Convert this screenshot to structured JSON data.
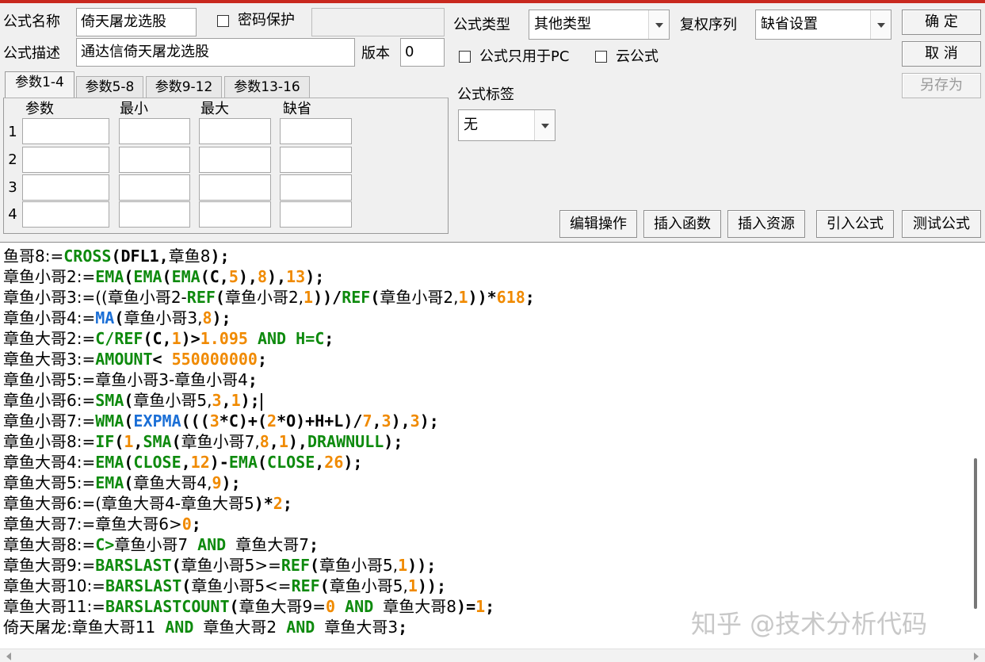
{
  "header": {
    "name_label": "公式名称",
    "name_value": "倚天屠龙选股",
    "password_label": "密码保护",
    "password_value": "",
    "desc_label": "公式描述",
    "desc_value": "通达信倚天屠龙选股",
    "version_label": "版本",
    "version_value": "0",
    "type_label": "公式类型",
    "type_value": "其他类型",
    "rights_label": "复权序列",
    "rights_value": "缺省设置",
    "pc_only_label": "公式只用于PC",
    "cloud_label": "云公式",
    "tag_label": "公式标签",
    "tag_value": "无"
  },
  "buttons": {
    "ok": "确 定",
    "cancel": "取 消",
    "save_as": "另存为",
    "edit_ops": "编辑操作",
    "insert_func": "插入函数",
    "insert_res": "插入资源",
    "import": "引入公式",
    "test": "测试公式"
  },
  "tabs": [
    "参数1-4",
    "参数5-8",
    "参数9-12",
    "参数13-16"
  ],
  "params": {
    "headers": [
      "参数",
      "最小",
      "最大",
      "缺省"
    ],
    "rows": [
      "1",
      "2",
      "3",
      "4"
    ]
  },
  "code_lines": [
    [
      [
        "鱼哥8:=",
        "t"
      ],
      [
        "CROSS",
        "f"
      ],
      [
        "(DFL1,",
        "p"
      ],
      [
        "章鱼8",
        "t"
      ],
      [
        ");",
        "p"
      ]
    ],
    [
      [
        "章鱼小哥2:=",
        "t"
      ],
      [
        "EMA",
        "f"
      ],
      [
        "(",
        "p"
      ],
      [
        "EMA",
        "f"
      ],
      [
        "(",
        "p"
      ],
      [
        "EMA",
        "f"
      ],
      [
        "(C,",
        "p"
      ],
      [
        "5",
        "n"
      ],
      [
        "),",
        "p"
      ],
      [
        "8",
        "n"
      ],
      [
        "),",
        "p"
      ],
      [
        "13",
        "n"
      ],
      [
        ");",
        "p"
      ]
    ],
    [
      [
        "章鱼小哥3:=((",
        "t"
      ],
      [
        "章鱼小哥2-",
        "t"
      ],
      [
        "REF",
        "f"
      ],
      [
        "(",
        "p"
      ],
      [
        "章鱼小哥2,",
        "t"
      ],
      [
        "1",
        "n"
      ],
      [
        "))/",
        "p"
      ],
      [
        "REF",
        "f"
      ],
      [
        "(",
        "p"
      ],
      [
        "章鱼小哥2,",
        "t"
      ],
      [
        "1",
        "n"
      ],
      [
        "))*",
        "p"
      ],
      [
        "618",
        "n"
      ],
      [
        ";",
        "p"
      ]
    ],
    [
      [
        "章鱼小哥4:=",
        "t"
      ],
      [
        "MA",
        "b"
      ],
      [
        "(",
        "p"
      ],
      [
        "章鱼小哥3,",
        "t"
      ],
      [
        "8",
        "n"
      ],
      [
        ");",
        "p"
      ]
    ],
    [
      [
        "章鱼大哥2:=",
        "t"
      ],
      [
        "C/",
        "f"
      ],
      [
        "REF",
        "f"
      ],
      [
        "(C,",
        "p"
      ],
      [
        "1",
        "n"
      ],
      [
        ")>",
        "p"
      ],
      [
        "1.095",
        "n"
      ],
      [
        " AND ",
        "f"
      ],
      [
        "H=C",
        "f"
      ],
      [
        ";",
        "p"
      ]
    ],
    [
      [
        "章鱼大哥3:=",
        "t"
      ],
      [
        "AMOUNT",
        "f"
      ],
      [
        "< ",
        "p"
      ],
      [
        "550000000",
        "n"
      ],
      [
        ";",
        "p"
      ]
    ],
    [
      [
        "章鱼小哥5:=",
        "t"
      ],
      [
        "章鱼小哥3-章鱼小哥4",
        "t"
      ],
      [
        ";",
        "p"
      ]
    ],
    [
      [
        "章鱼小哥6:=",
        "t"
      ],
      [
        "SMA",
        "f"
      ],
      [
        "(",
        "p"
      ],
      [
        "章鱼小哥5,",
        "t"
      ],
      [
        "3",
        "n"
      ],
      [
        ",",
        "p"
      ],
      [
        "1",
        "n"
      ],
      [
        ");",
        "p"
      ]
    ],
    [
      [
        "章鱼小哥7:=",
        "t"
      ],
      [
        "WMA",
        "f"
      ],
      [
        "(",
        "p"
      ],
      [
        "EXPMA",
        "b"
      ],
      [
        "(((",
        "p"
      ],
      [
        "3",
        "n"
      ],
      [
        "*C)+(",
        "p"
      ],
      [
        "2",
        "n"
      ],
      [
        "*O)+H+L)/",
        "p"
      ],
      [
        "7",
        "n"
      ],
      [
        ",",
        "p"
      ],
      [
        "3",
        "n"
      ],
      [
        "),",
        "p"
      ],
      [
        "3",
        "n"
      ],
      [
        ");",
        "p"
      ]
    ],
    [
      [
        "章鱼小哥8:=",
        "t"
      ],
      [
        "IF",
        "f"
      ],
      [
        "(",
        "p"
      ],
      [
        "1",
        "n"
      ],
      [
        ",",
        "p"
      ],
      [
        "SMA",
        "f"
      ],
      [
        "(",
        "p"
      ],
      [
        "章鱼小哥7,",
        "t"
      ],
      [
        "8",
        "n"
      ],
      [
        ",",
        "p"
      ],
      [
        "1",
        "n"
      ],
      [
        "),",
        "p"
      ],
      [
        "DRAWNULL",
        "f"
      ],
      [
        ");",
        "p"
      ]
    ],
    [
      [
        "章鱼大哥4:=",
        "t"
      ],
      [
        "EMA",
        "f"
      ],
      [
        "(",
        "p"
      ],
      [
        "CLOSE",
        "f"
      ],
      [
        ",",
        "p"
      ],
      [
        "12",
        "n"
      ],
      [
        ")-",
        "p"
      ],
      [
        "EMA",
        "f"
      ],
      [
        "(",
        "p"
      ],
      [
        "CLOSE",
        "f"
      ],
      [
        ",",
        "p"
      ],
      [
        "26",
        "n"
      ],
      [
        ");",
        "p"
      ]
    ],
    [
      [
        "章鱼大哥5:=",
        "t"
      ],
      [
        "EMA",
        "f"
      ],
      [
        "(",
        "p"
      ],
      [
        "章鱼大哥4,",
        "t"
      ],
      [
        "9",
        "n"
      ],
      [
        ");",
        "p"
      ]
    ],
    [
      [
        "章鱼大哥6:=(",
        "t"
      ],
      [
        "章鱼大哥4-章鱼大哥5",
        "t"
      ],
      [
        ")*",
        "p"
      ],
      [
        "2",
        "n"
      ],
      [
        ";",
        "p"
      ]
    ],
    [
      [
        "章鱼大哥7:=",
        "t"
      ],
      [
        "章鱼大哥6>",
        "t"
      ],
      [
        "0",
        "n"
      ],
      [
        ";",
        "p"
      ]
    ],
    [
      [
        "章鱼大哥8:=",
        "t"
      ],
      [
        "C>",
        "f"
      ],
      [
        "章鱼小哥7",
        "t"
      ],
      [
        " AND ",
        "f"
      ],
      [
        "章鱼大哥7",
        "t"
      ],
      [
        ";",
        "p"
      ]
    ],
    [
      [
        "章鱼大哥9:=",
        "t"
      ],
      [
        "BARSLAST",
        "f"
      ],
      [
        "(",
        "p"
      ],
      [
        "章鱼小哥5>=",
        "t"
      ],
      [
        "REF",
        "f"
      ],
      [
        "(",
        "p"
      ],
      [
        "章鱼小哥5,",
        "t"
      ],
      [
        "1",
        "n"
      ],
      [
        "));",
        "p"
      ]
    ],
    [
      [
        "章鱼大哥10:=",
        "t"
      ],
      [
        "BARSLAST",
        "f"
      ],
      [
        "(",
        "p"
      ],
      [
        "章鱼小哥5<=",
        "t"
      ],
      [
        "REF",
        "f"
      ],
      [
        "(",
        "p"
      ],
      [
        "章鱼小哥5,",
        "t"
      ],
      [
        "1",
        "n"
      ],
      [
        "));",
        "p"
      ]
    ],
    [
      [
        "章鱼大哥11:=",
        "t"
      ],
      [
        "BARSLASTCOUNT",
        "f"
      ],
      [
        "(",
        "p"
      ],
      [
        "章鱼大哥9=",
        "t"
      ],
      [
        "0",
        "n"
      ],
      [
        " AND ",
        "f"
      ],
      [
        "章鱼大哥8",
        "t"
      ],
      [
        ")=",
        "p"
      ],
      [
        "1",
        "n"
      ],
      [
        ";",
        "p"
      ]
    ],
    [
      [
        "倚天屠龙:",
        "t"
      ],
      [
        "章鱼大哥11",
        "t"
      ],
      [
        " AND ",
        "f"
      ],
      [
        "章鱼大哥2",
        "t"
      ],
      [
        " AND ",
        "f"
      ],
      [
        "章鱼大哥3",
        "t"
      ],
      [
        ";",
        "p"
      ]
    ]
  ],
  "watermark": "知乎 @技术分析代码"
}
